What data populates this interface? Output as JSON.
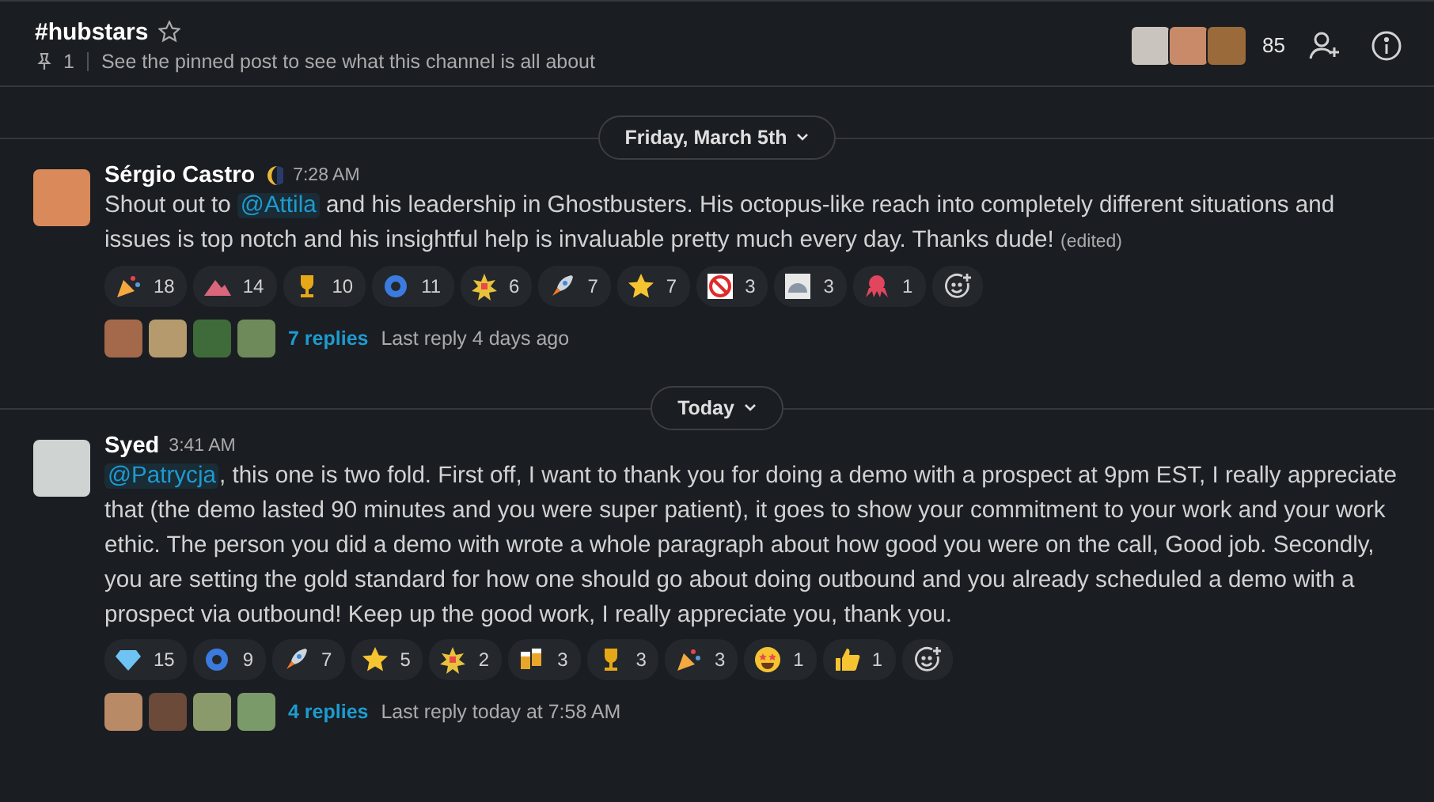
{
  "channel": {
    "name": "#hubstars",
    "starred": false,
    "pin_count": "1",
    "topic": "See the pinned post to see what this channel is all about",
    "member_count": "85",
    "member_avatars": [
      {
        "color": "#c9c4bd"
      },
      {
        "color": "#c98a6a"
      },
      {
        "color": "#9a6a3a"
      }
    ]
  },
  "sections": [
    {
      "date": "Friday, March 5th",
      "messages": [
        {
          "author": "Sérgio Castro",
          "status_shown": true,
          "time": "7:28 AM",
          "body": [
            {
              "kind": "text",
              "text": "Shout out to "
            },
            {
              "kind": "mention",
              "text": "@Attila"
            },
            {
              "kind": "text",
              "text": " and his leadership in Ghostbusters. His octopus-like reach into completely different situations and issues is top notch and his insightful help is invaluable pretty much every day. Thanks dude!"
            }
          ],
          "edited": "(edited)",
          "reactions": [
            {
              "kind": "party",
              "count": "18"
            },
            {
              "kind": "mountain",
              "count": "14"
            },
            {
              "kind": "trophy",
              "count": "10"
            },
            {
              "kind": "logo",
              "count": "11"
            },
            {
              "kind": "burst",
              "count": "6"
            },
            {
              "kind": "rocket",
              "count": "7"
            },
            {
              "kind": "star",
              "count": "7"
            },
            {
              "kind": "no-ghost",
              "count": "3"
            },
            {
              "kind": "helmet",
              "count": "3"
            },
            {
              "kind": "octopus",
              "count": "1"
            }
          ],
          "thread": {
            "avatars": [
              {
                "color": "#a4694a"
              },
              {
                "color": "#b59a6e"
              },
              {
                "color": "#3f6b3a"
              },
              {
                "color": "#6e8a5a"
              }
            ],
            "replies": "7 replies",
            "last_reply": "Last reply 4 days ago"
          }
        }
      ]
    },
    {
      "date": "Today",
      "messages": [
        {
          "author": "Syed",
          "time": "3:41 AM",
          "body": [
            {
              "kind": "mention",
              "text": "@Patrycja"
            },
            {
              "kind": "text",
              "text": ", this one is two fold. First off, I want to thank you for doing a demo with a prospect at 9pm EST, I really appreciate that (the demo lasted 90 minutes and you were super patient), it goes to show your commitment to your work and your work ethic. The person you did a demo with wrote a whole paragraph about how good you were on the call, Good job. Secondly, you are setting the gold standard for how one should go about doing outbound and you already scheduled a demo with a prospect via outbound! Keep up the good work, I really appreciate you, thank you."
            }
          ],
          "reactions": [
            {
              "kind": "diamond",
              "count": "15"
            },
            {
              "kind": "logo",
              "count": "9"
            },
            {
              "kind": "rocket",
              "count": "7"
            },
            {
              "kind": "star",
              "count": "5"
            },
            {
              "kind": "burst",
              "count": "2"
            },
            {
              "kind": "beers",
              "count": "3"
            },
            {
              "kind": "trophy",
              "count": "3"
            },
            {
              "kind": "party",
              "count": "3"
            },
            {
              "kind": "star-struck",
              "count": "1"
            },
            {
              "kind": "thumbs-up",
              "count": "1"
            }
          ],
          "thread": {
            "avatars": [
              {
                "color": "#b88a66"
              },
              {
                "color": "#6b4a3a"
              },
              {
                "color": "#8a9a6a"
              },
              {
                "color": "#7a9a6a"
              }
            ],
            "replies": "4 replies",
            "last_reply": "Last reply today at 7:58 AM"
          }
        }
      ]
    }
  ]
}
